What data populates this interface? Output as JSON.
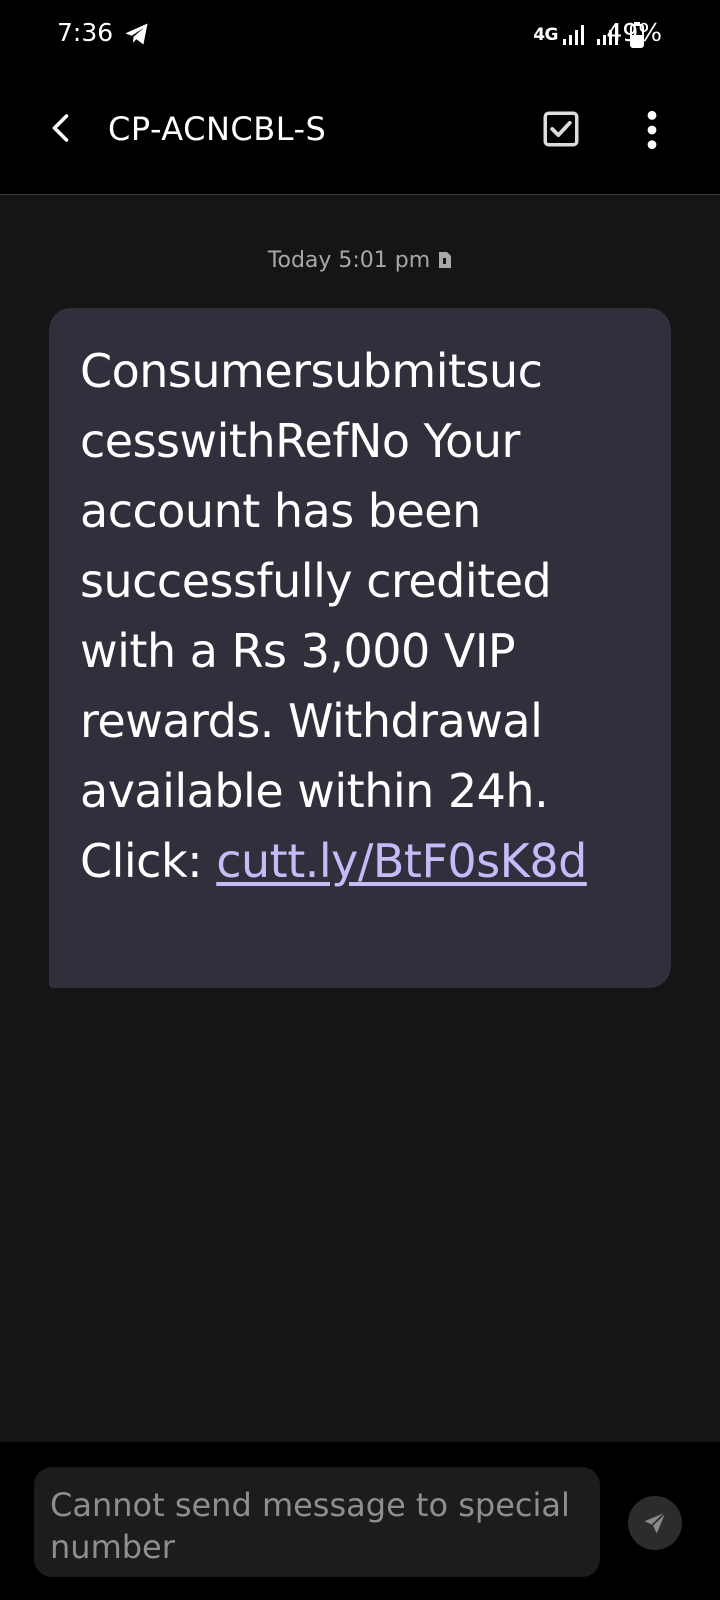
{
  "status_bar": {
    "time": "7:36",
    "network": "4G",
    "battery": "49%"
  },
  "header": {
    "title": "CP-ACNCBL-S"
  },
  "conversation": {
    "timestamp": "Today 5:01 pm",
    "message": {
      "text_main": "Consumersubmitsuc cesswithRefNo Your account has been successfully credited with a Rs 3,000 VIP rewards. Withdrawal available within 24h. Click: ",
      "link": "cutt.ly/BtF0sK8d"
    }
  },
  "composer": {
    "notice": "Cannot send message to special number"
  },
  "colors": {
    "background": "#151515",
    "bubble": "#302f3c",
    "link": "#c6bbf8",
    "bar": "#000000"
  },
  "icons": {
    "back": "arrow-left-icon",
    "select": "checkbox-icon",
    "more": "more-vert-icon",
    "send": "send-icon",
    "sim": "sim-icon",
    "telegram": "telegram-icon"
  }
}
